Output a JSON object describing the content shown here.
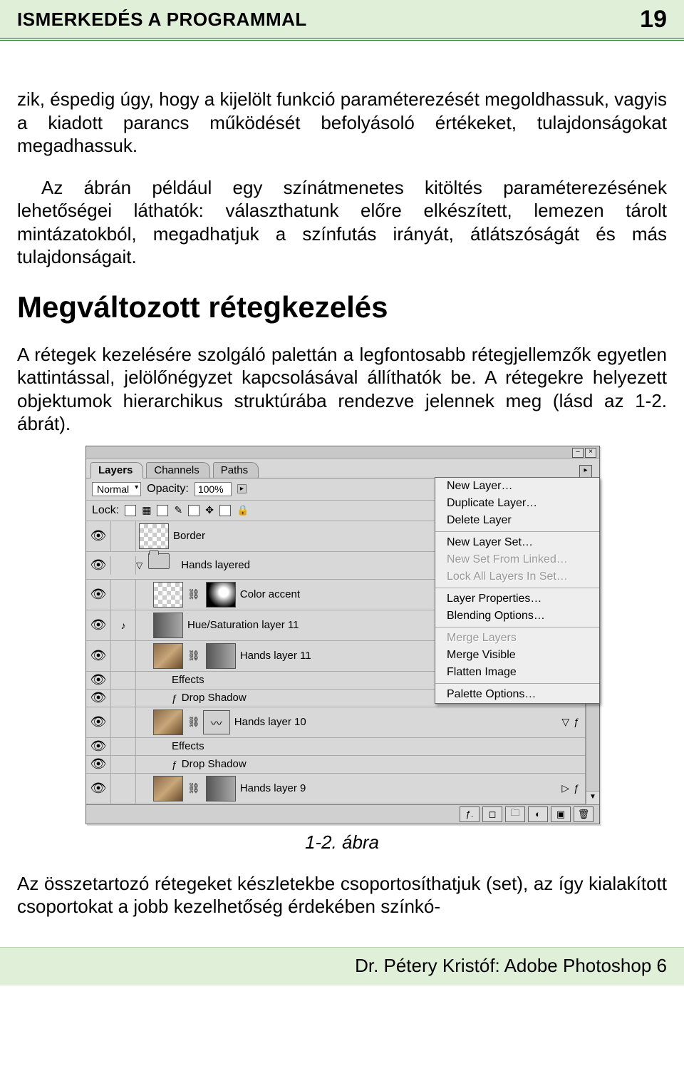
{
  "header": {
    "title": "ISMERKEDÉS A PROGRAMMAL",
    "page_number": "19"
  },
  "body": {
    "p1": "zik, éspedig úgy, hogy a kijelölt funkció paraméterezését megoldhassuk, vagyis a kiadott parancs működését befolyásoló értékeket, tulajdonságokat megadhassuk.",
    "p2": "Az ábrán például egy színátmenetes kitöltés paraméterezésének lehetőségei láthatók: választhatunk előre elkészített, lemezen tárolt mintázatokból, megadhatjuk a színfutás irányát, átlátszóságát és más tulajdonságait.",
    "h2": "Megváltozott rétegkezelés",
    "p3": "A rétegek kezelésére szolgáló palettán a legfontosabb rétegjellemzők egyetlen kattintással, jelölőnégyzet kapcsolásával állíthatók be. A rétegekre helyezett objektumok hierarchikus struktúrába rendezve jelennek meg (lásd az 1-2. ábrát).",
    "caption": "1-2. ábra",
    "p4": "Az összetartozó rétegeket készletekbe csoportosíthatjuk (set), az így kialakított csoportokat a jobb kezelhetőség érdekében színkó-"
  },
  "palette": {
    "tabs": {
      "layers": "Layers",
      "channels": "Channels",
      "paths": "Paths"
    },
    "blend_mode": "Normal",
    "opacity_label": "Opacity:",
    "opacity_value": "100%",
    "lock_label": "Lock:",
    "layers": {
      "border": "Border",
      "hands_layered": "Hands layered",
      "color_accent": "Color accent",
      "hue_sat": "Hue/Saturation layer 11",
      "hands11": "Hands layer 11",
      "effects": "Effects",
      "drop_shadow": "Drop Shadow",
      "hands10": "Hands layer 10",
      "hands9": "Hands layer 9"
    }
  },
  "menu": {
    "new_layer": "New Layer…",
    "duplicate_layer": "Duplicate Layer…",
    "delete_layer": "Delete Layer",
    "new_layer_set": "New Layer Set…",
    "new_set_linked": "New Set From Linked…",
    "lock_all": "Lock All Layers In Set…",
    "layer_props": "Layer Properties…",
    "blending_opts": "Blending Options…",
    "merge_layers": "Merge Layers",
    "merge_visible": "Merge Visible",
    "flatten": "Flatten Image",
    "palette_opts": "Palette Options…"
  },
  "footer": "Dr. Pétery Kristóf: Adobe Photoshop 6"
}
